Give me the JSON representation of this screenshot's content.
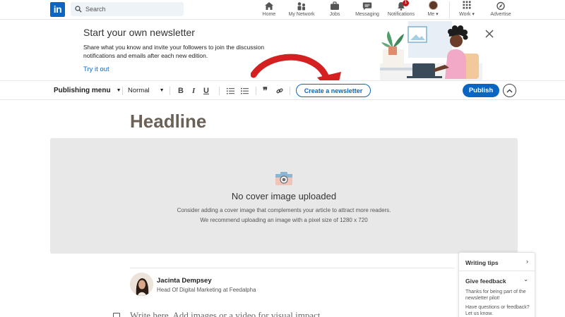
{
  "nav": {
    "logo_text": "in",
    "search_placeholder": "Search",
    "items": [
      {
        "label": "Home",
        "icon": "home-icon"
      },
      {
        "label": "My Network",
        "icon": "network-icon"
      },
      {
        "label": "Jobs",
        "icon": "briefcase-icon"
      },
      {
        "label": "Messaging",
        "icon": "messaging-icon"
      },
      {
        "label": "Notifications",
        "icon": "bell-icon",
        "badge": "1"
      },
      {
        "label": "Me",
        "icon": "avatar"
      },
      {
        "label": "Work",
        "icon": "grid-icon"
      },
      {
        "label": "Advertise",
        "icon": "compass-icon"
      }
    ]
  },
  "banner": {
    "title": "Start your own newsletter",
    "description": "Share what you know and invite your followers to join the discussion notifications and emails after each new edition.",
    "link": "Try it out"
  },
  "toolbar": {
    "publishing_menu": "Publishing menu",
    "style_value": "Normal",
    "create_newsletter": "Create a newsletter",
    "publish": "Publish"
  },
  "editor": {
    "headline": "Headline",
    "cover_title": "No cover image uploaded",
    "cover_desc_1": "Consider adding a cover image that complements your article to attract more readers.",
    "cover_desc_2": "We recommend uploading an image with a pixel size of 1280 x 720",
    "author_name": "Jacinta Dempsey",
    "author_title": "Head Of Digital Marketing at Feedalpha",
    "body_placeholder": "Write here. Add images or a video for visual impact."
  },
  "side_panel": {
    "writing_tips": "Writing tips",
    "give_feedback": "Give feedback",
    "feedback_text_1": "Thanks for being part of the newsletter pilot!",
    "feedback_text_2": "Have questions or feedback? Let us know."
  },
  "colors": {
    "brand": "#0a66c2",
    "badge": "#cc1016",
    "arrow": "#d42020"
  }
}
